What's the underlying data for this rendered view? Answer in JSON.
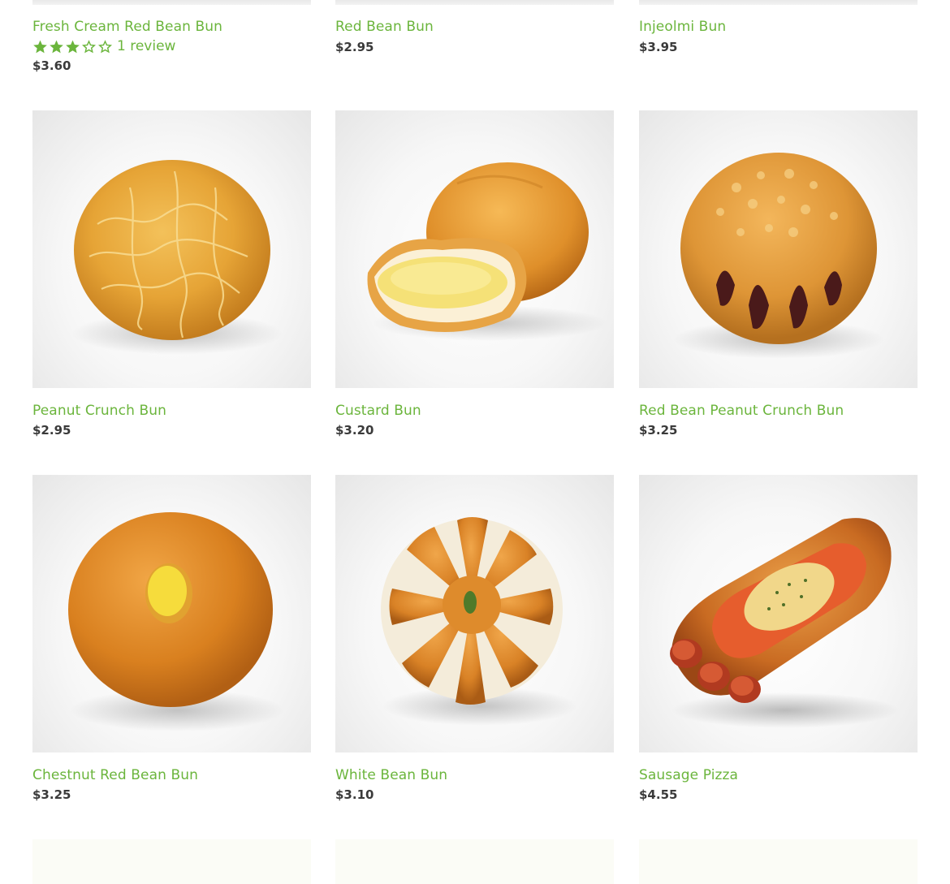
{
  "rows": [
    {
      "products": [
        {
          "title": "Fresh Cream Red Bean Bun",
          "price": "$3.60",
          "rating": 3,
          "rating_max": 5,
          "review_text": "1 review"
        },
        {
          "title": "Red Bean Bun",
          "price": "$2.95"
        },
        {
          "title": "Injeolmi Bun",
          "price": "$3.95"
        }
      ]
    },
    {
      "products": [
        {
          "title": "Peanut Crunch Bun",
          "price": "$2.95",
          "image_icon": "peanut-crunch-bun-photo"
        },
        {
          "title": "Custard Bun",
          "price": "$3.20",
          "image_icon": "custard-bun-photo"
        },
        {
          "title": "Red Bean Peanut Crunch Bun",
          "price": "$3.25",
          "image_icon": "red-bean-peanut-crunch-bun-photo"
        }
      ]
    },
    {
      "products": [
        {
          "title": "Chestnut Red Bean Bun",
          "price": "$3.25",
          "image_icon": "chestnut-red-bean-bun-photo"
        },
        {
          "title": "White Bean Bun",
          "price": "$3.10",
          "image_icon": "white-bean-bun-photo"
        },
        {
          "title": "Sausage Pizza",
          "price": "$4.55",
          "image_icon": "sausage-pizza-photo"
        }
      ]
    }
  ],
  "colors": {
    "title": "#6bb53c",
    "price": "#3a3a3a",
    "star": "#6bb53c"
  }
}
